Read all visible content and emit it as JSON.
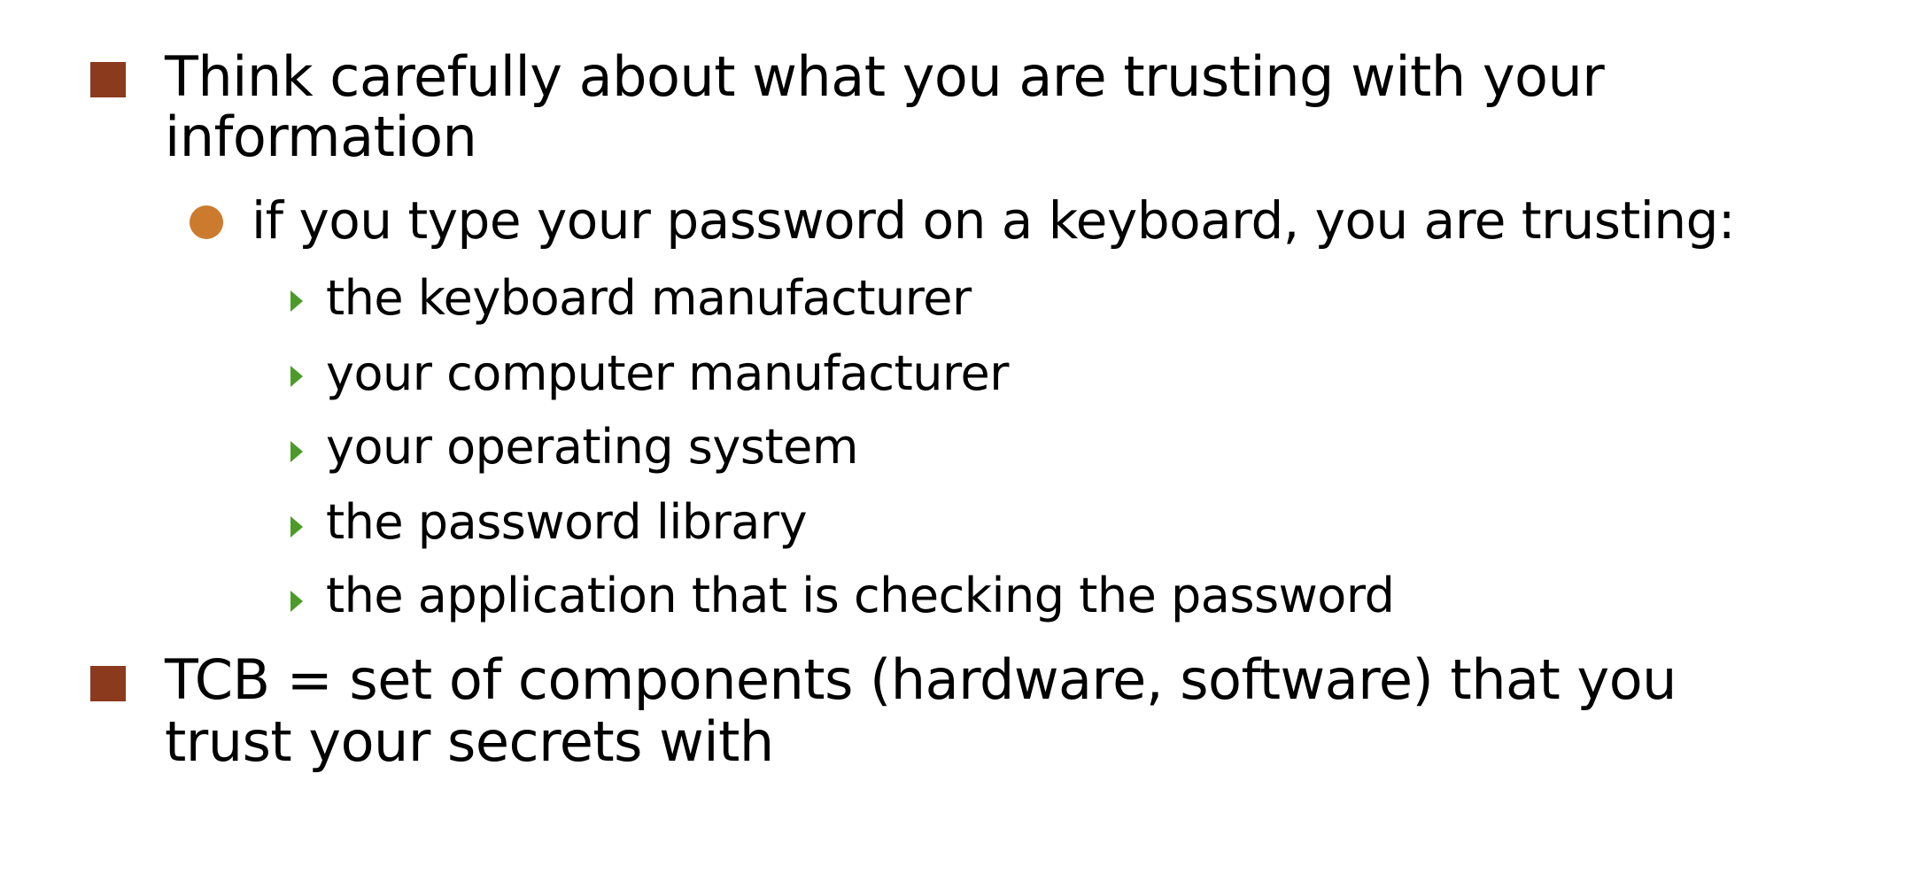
{
  "slide": {
    "bullets": [
      {
        "text": "Think carefully about what you are trusting with your information",
        "line1": "Think carefully about what you are trusting with your",
        "line2": "information",
        "sub": {
          "text": "if you type your password on a keyboard, you are trusting:",
          "items": [
            "the keyboard manufacturer",
            "your computer manufacturer",
            "your operating system",
            "the password library",
            "the application that is checking the password"
          ]
        }
      },
      {
        "text": "TCB = set of components (hardware, software) that you trust your secrets with",
        "line1": "TCB = set of components (hardware, software) that you",
        "line2": "trust your secrets with"
      }
    ]
  },
  "colors": {
    "level1_bullet": "#8B3A1E",
    "level2_bullet": "#CC7A2E",
    "level3_bullet": "#4C9A2A"
  },
  "icons": {
    "level1": "square-bullet-icon",
    "level2": "circle-bullet-icon",
    "level3": "triangle-bullet-icon"
  }
}
